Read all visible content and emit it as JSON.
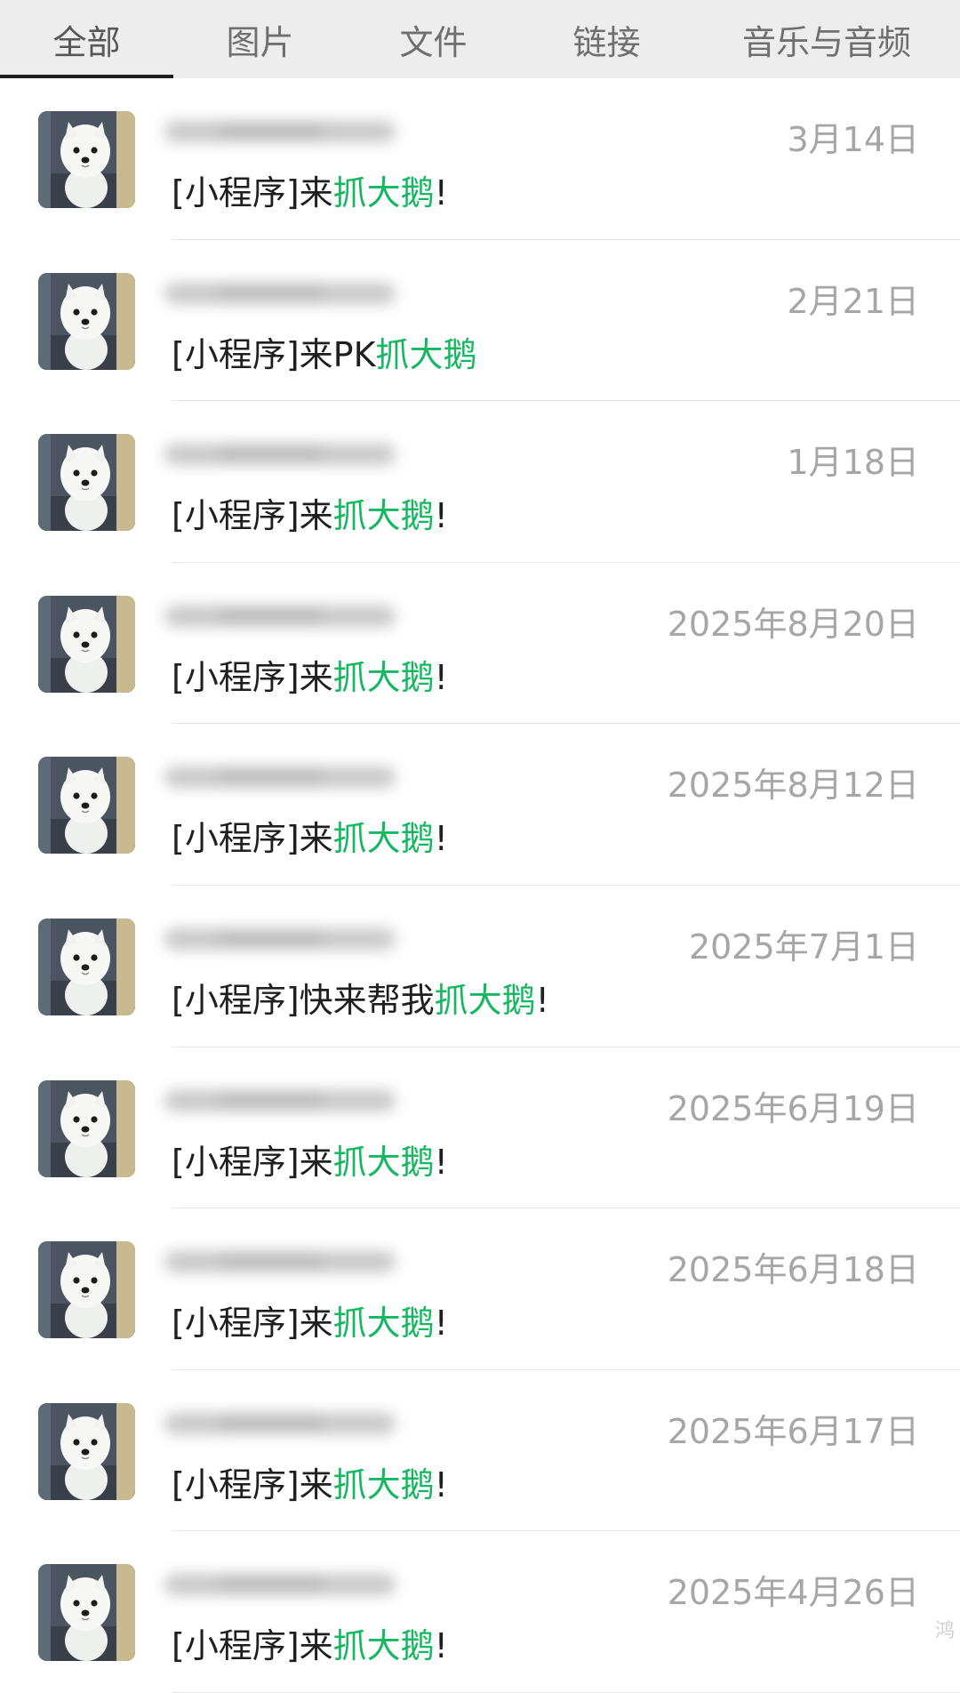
{
  "tabs": [
    {
      "label": "全部",
      "active": true
    },
    {
      "label": "图片",
      "active": false
    },
    {
      "label": "文件",
      "active": false
    },
    {
      "label": "链接",
      "active": false
    },
    {
      "label": "音乐与音频",
      "active": false
    }
  ],
  "accent_color": "#15b860",
  "messages": [
    {
      "date": "3月14日",
      "prefix": "[小程序]来",
      "highlight": "抓大鹅",
      "suffix": "!"
    },
    {
      "date": "2月21日",
      "prefix": "[小程序]来PK",
      "highlight": "抓大鹅",
      "suffix": ""
    },
    {
      "date": "1月18日",
      "prefix": "[小程序]来",
      "highlight": "抓大鹅",
      "suffix": "!"
    },
    {
      "date": "2025年8月20日",
      "prefix": "[小程序]来",
      "highlight": "抓大鹅",
      "suffix": "!"
    },
    {
      "date": "2025年8月12日",
      "prefix": "[小程序]来",
      "highlight": "抓大鹅",
      "suffix": "!"
    },
    {
      "date": "2025年7月1日",
      "prefix": "[小程序]快来帮我",
      "highlight": "抓大鹅",
      "suffix": "!"
    },
    {
      "date": "2025年6月19日",
      "prefix": "[小程序]来",
      "highlight": "抓大鹅",
      "suffix": "!"
    },
    {
      "date": "2025年6月18日",
      "prefix": "[小程序]来",
      "highlight": "抓大鹅",
      "suffix": "!"
    },
    {
      "date": "2025年6月17日",
      "prefix": "[小程序]来",
      "highlight": "抓大鹅",
      "suffix": "!"
    },
    {
      "date": "2025年4月26日",
      "prefix": "[小程序]来",
      "highlight": "抓大鹅",
      "suffix": "!"
    }
  ],
  "watermark": "鸿"
}
